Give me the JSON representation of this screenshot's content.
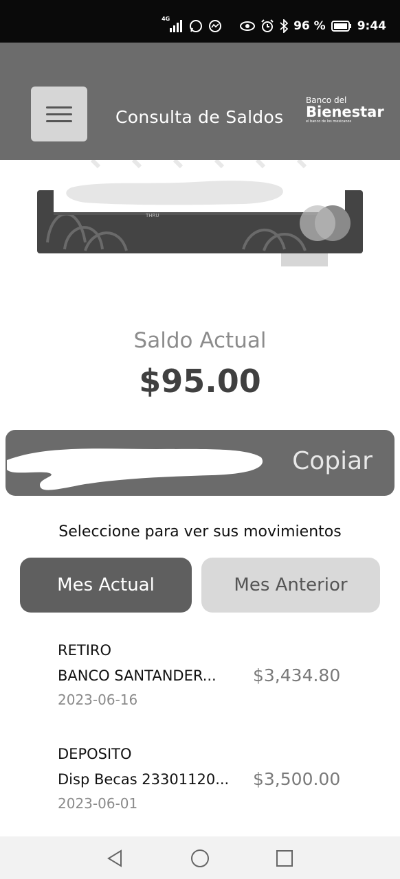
{
  "status_bar": {
    "network": "4G",
    "battery": "96 %",
    "time": "9:44",
    "icons": [
      "signal-icon",
      "whatsapp-icon",
      "messenger-icon",
      "eye-icon",
      "alarm-icon",
      "bluetooth-icon",
      "battery-icon"
    ]
  },
  "header": {
    "title": "Consulta de Saldos",
    "menu_icon": "hamburger-menu-icon",
    "logo": {
      "line1": "Banco del",
      "line2": "Bienestar",
      "line3": "el banco de los mexicanos"
    }
  },
  "card": {
    "label": "THRU",
    "obscured": true
  },
  "balance": {
    "label": "Saldo Actual",
    "amount": "$95.00"
  },
  "account": {
    "copy_label": "Copiar",
    "number_obscured": true
  },
  "movements_prompt": "Seleccione para ver sus movimientos",
  "tabs": [
    {
      "label": "Mes Actual",
      "active": true
    },
    {
      "label": "Mes Anterior",
      "active": false
    }
  ],
  "movements": [
    {
      "type": "RETIRO",
      "description": "BANCO SANTANDER...",
      "amount": "$3,434.80",
      "date": "2023-06-16"
    },
    {
      "type": "DEPOSITO",
      "description": "Disp Becas 23301120...",
      "amount": "$3,500.00",
      "date": "2023-06-01"
    }
  ],
  "nav": {
    "icons": [
      "back-icon",
      "home-icon",
      "recents-icon"
    ]
  },
  "colors": {
    "header_bg": "#6c6c6c",
    "active_tab": "#5f5f5f",
    "inactive_tab": "#d9d9d9",
    "account_bar": "#6b6b6b"
  }
}
